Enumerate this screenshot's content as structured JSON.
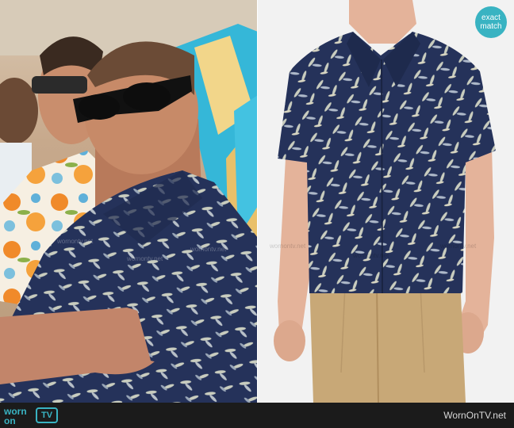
{
  "badge": {
    "line1": "exact",
    "line2": "match"
  },
  "footer": {
    "logo_word1": "worn",
    "logo_word2": "on",
    "logo_tv": "TV",
    "site": "WornOnTV.net"
  },
  "watermark": "wornontv.net",
  "colors": {
    "shirt_navy": "#25325a",
    "leaf": "#c9cdbf",
    "chino": "#c8a877",
    "badge": "#39b3c2",
    "bar": "#1b1b1b"
  }
}
